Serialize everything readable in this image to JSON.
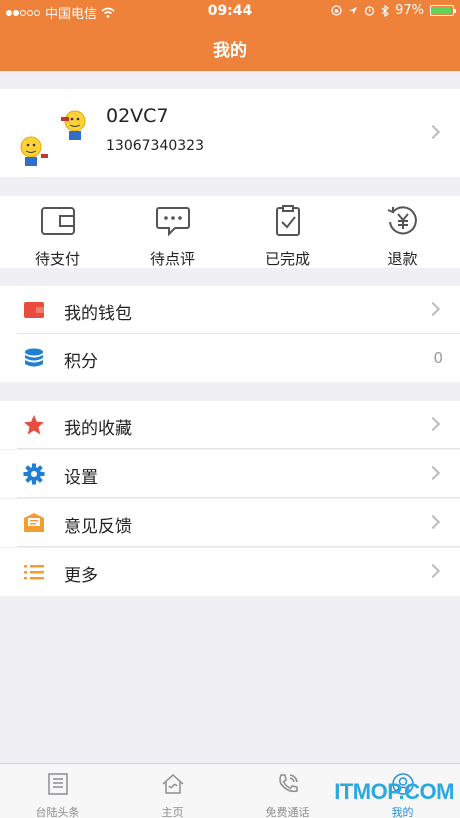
{
  "status_bar": {
    "carrier": "中国电信",
    "time": "09:44",
    "battery": "97%"
  },
  "header": {
    "title": "我的"
  },
  "profile": {
    "username": "02VC7",
    "phone": "13067340323"
  },
  "orders": [
    {
      "label": "待支付",
      "icon": "wallet-icon"
    },
    {
      "label": "待点评",
      "icon": "comment-icon"
    },
    {
      "label": "已完成",
      "icon": "clipboard-check-icon"
    },
    {
      "label": "退款",
      "icon": "refund-yen-icon"
    }
  ],
  "menu_group1": [
    {
      "label": "我的钱包",
      "icon": "red-wallet-icon",
      "color": "#e84c3d"
    },
    {
      "label": "积分",
      "icon": "coin-stack-icon",
      "value": "0",
      "color": "#1f7fd4"
    }
  ],
  "menu_group2": [
    {
      "label": "我的收藏",
      "icon": "star-icon",
      "color": "#e84c3d"
    },
    {
      "label": "设置",
      "icon": "gear-icon",
      "color": "#1f7fd4"
    },
    {
      "label": "意见反馈",
      "icon": "feedback-icon",
      "color": "#f39c33"
    },
    {
      "label": "更多",
      "icon": "list-icon",
      "color": "#f39c33"
    }
  ],
  "tabbar": [
    {
      "label": "台陆头条",
      "icon": "news-icon"
    },
    {
      "label": "主页",
      "icon": "home-icon"
    },
    {
      "label": "免费通话",
      "icon": "phone-icon"
    },
    {
      "label": "我的",
      "icon": "user-icon",
      "active": true
    }
  ],
  "watermark": "ITMOP.COM",
  "accent_color": "#ef823a"
}
